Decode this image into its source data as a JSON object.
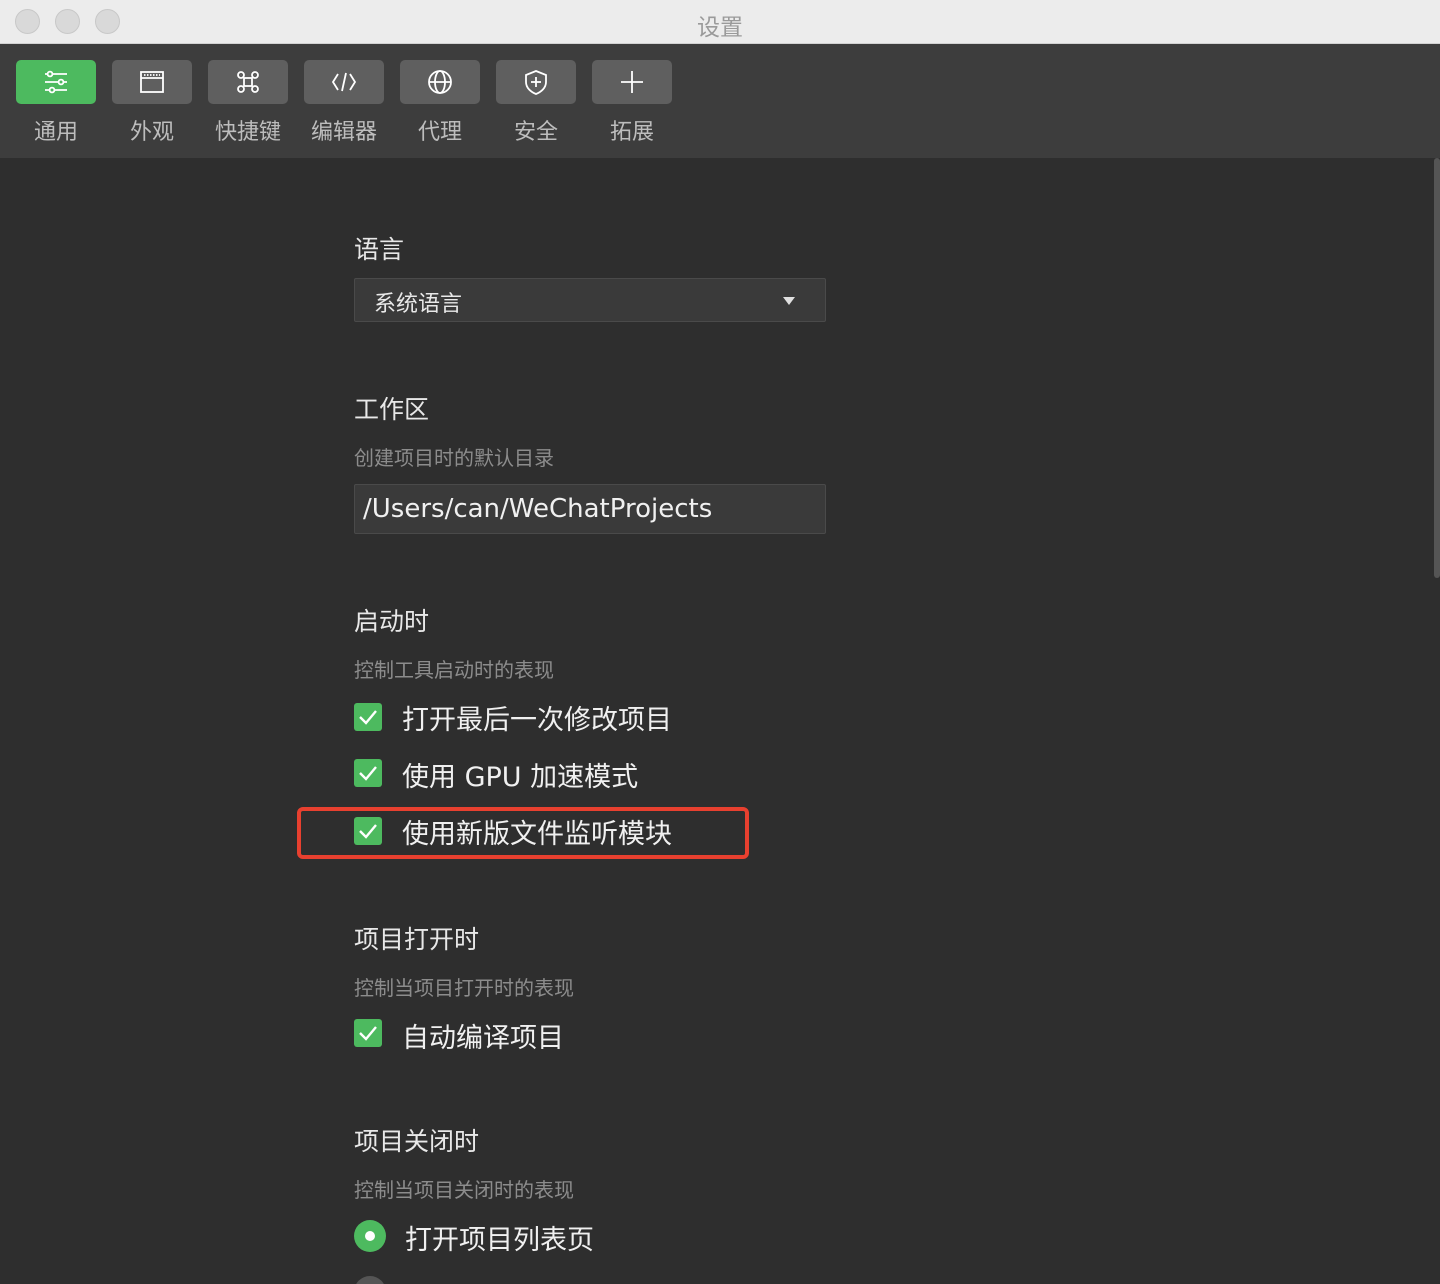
{
  "window": {
    "title": "设置"
  },
  "toolbar": {
    "tabs": [
      {
        "label": "通用",
        "icon": "sliders-icon",
        "active": true
      },
      {
        "label": "外观",
        "icon": "window-icon",
        "active": false
      },
      {
        "label": "快捷键",
        "icon": "command-icon",
        "active": false
      },
      {
        "label": "编辑器",
        "icon": "code-icon",
        "active": false
      },
      {
        "label": "代理",
        "icon": "globe-icon",
        "active": false
      },
      {
        "label": "安全",
        "icon": "shield-icon",
        "active": false
      },
      {
        "label": "拓展",
        "icon": "plus-icon",
        "active": false
      }
    ]
  },
  "language": {
    "heading": "语言",
    "selected": "系统语言"
  },
  "workspace": {
    "heading": "工作区",
    "desc": "创建项目时的默认目录",
    "path": "/Users/can/WeChatProjects"
  },
  "startup": {
    "heading": "启动时",
    "desc": "控制工具启动时的表现",
    "options": [
      {
        "label": "打开最后一次修改项目",
        "checked": true
      },
      {
        "label": "使用 GPU 加速模式",
        "checked": true
      },
      {
        "label": "使用新版文件监听模块",
        "checked": true
      }
    ]
  },
  "project_open": {
    "heading": "项目打开时",
    "desc": "控制当项目打开时的表现",
    "options": [
      {
        "label": "自动编译项目",
        "checked": true
      }
    ]
  },
  "project_close": {
    "heading": "项目关闭时",
    "desc": "控制当项目关闭时的表现",
    "options": [
      {
        "label": "打开项目列表页",
        "selected": true
      }
    ]
  },
  "colors": {
    "accent": "#4dba5f",
    "highlight": "#e8402f"
  }
}
